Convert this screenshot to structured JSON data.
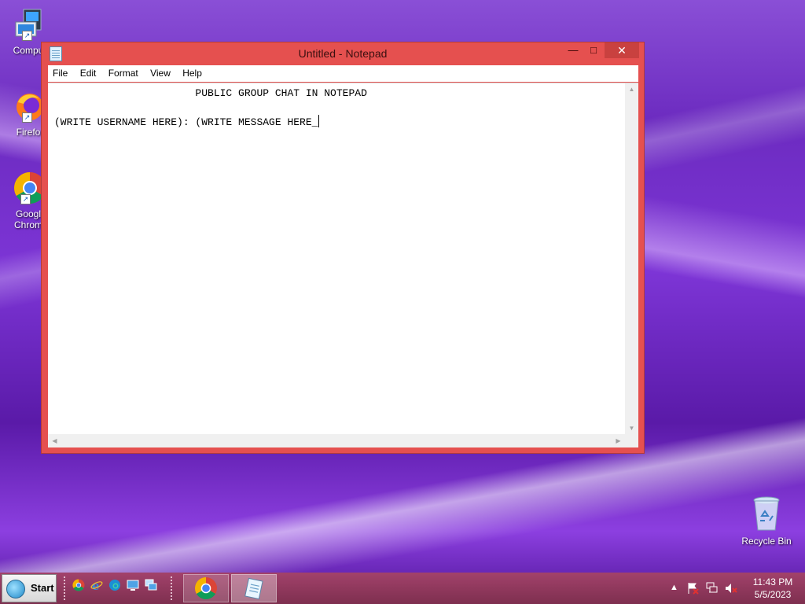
{
  "desktop": {
    "icons": [
      {
        "label": "Compu",
        "icon": "computer-icon"
      },
      {
        "label": "Firefox",
        "icon": "firefox-icon"
      },
      {
        "label": "Google Chrome",
        "icon": "chrome-icon"
      },
      {
        "label": "Recycle Bin",
        "icon": "recycle-bin-icon"
      }
    ],
    "icon_labels": {
      "computer": "Compu",
      "firefox": "Firefo",
      "chrome_line1": "Googl",
      "chrome_line2": "Chrom",
      "recycle": "Recycle Bin"
    }
  },
  "notepad": {
    "title": "Untitled - Notepad",
    "buttons": {
      "minimize": "—",
      "maximize": "□",
      "close": "✕"
    },
    "menu": {
      "file": "File",
      "edit": "Edit",
      "format": "Format",
      "view": "View",
      "help": "Help"
    },
    "content": {
      "line1": "                       PUBLIC GROUP CHAT IN NOTEPAD",
      "line2": "",
      "line3": "(WRITE USERNAME HERE): (WRITE MESSAGE HERE_"
    }
  },
  "taskbar": {
    "start_label": "Start",
    "quick_launch": [
      "chrome-icon",
      "internet-explorer-icon",
      "edge-icon",
      "show-desktop-icon",
      "switch-windows-icon"
    ],
    "tasks": [
      "chrome-icon",
      "notepad-icon"
    ],
    "tray": [
      "show-hidden-icons",
      "action-center-icon",
      "network-icon",
      "volume-muted-icon"
    ],
    "clock": {
      "time": "11:43 PM",
      "date": "5/5/2023"
    }
  },
  "colors": {
    "window_frame": "#e5504f",
    "close_button": "#c9413f",
    "taskbar": "#8e3658"
  }
}
